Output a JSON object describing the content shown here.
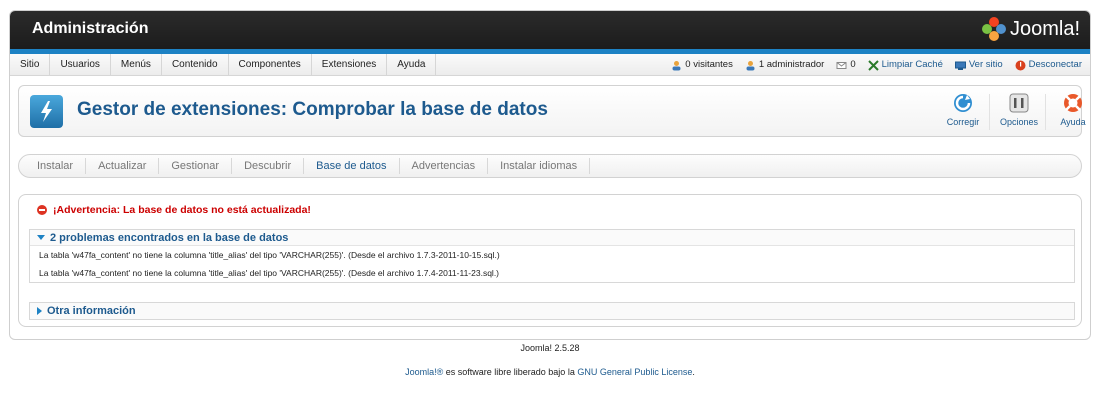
{
  "header": {
    "app_title": "Administración",
    "logo_text": "Joomla!"
  },
  "menu": {
    "items": [
      {
        "label": "Sitio"
      },
      {
        "label": "Usuarios"
      },
      {
        "label": "Menús"
      },
      {
        "label": "Contenido"
      },
      {
        "label": "Componentes"
      },
      {
        "label": "Extensiones"
      },
      {
        "label": "Ayuda"
      }
    ]
  },
  "status": {
    "visitors": "0 visitantes",
    "admins": "1 administrador",
    "messages": "0",
    "clear_cache": "Limpiar Caché",
    "view_site": "Ver sitio",
    "logout": "Desconectar"
  },
  "toolbar": {
    "title": "Gestor de extensiones: Comprobar la base de datos",
    "fix_label": "Corregir",
    "options_label": "Opciones",
    "help_label": "Ayuda"
  },
  "subnav": {
    "items": [
      {
        "label": "Instalar"
      },
      {
        "label": "Actualizar"
      },
      {
        "label": "Gestionar"
      },
      {
        "label": "Descubrir"
      },
      {
        "label": "Base de datos"
      },
      {
        "label": "Advertencias"
      },
      {
        "label": "Instalar idiomas"
      }
    ],
    "active_index": 4
  },
  "content": {
    "warning": "¡Advertencia: La base de datos no está actualizada!",
    "problems_heading": "2 problemas encontrados en la base de datos",
    "problems": [
      "La tabla 'w47fa_content' no tiene la columna 'title_alias' del tipo 'VARCHAR(255)'. (Desde el archivo 1.7.3-2011-10-15.sql.)",
      "La tabla 'w47fa_content' no tiene la columna 'title_alias' del tipo 'VARCHAR(255)'. (Desde el archivo 1.7.4-2011-11-23.sql.)"
    ],
    "other_info": "Otra información"
  },
  "footer": {
    "version": "Joomla! 2.5.28",
    "license_link_1": "Joomla!®",
    "license_text": " es software libre liberado bajo la ",
    "license_link_2": "GNU General Public License",
    "license_end": "."
  },
  "colors": {
    "accent": "#1d82c4",
    "title": "#1d5a8e",
    "warning": "#cc0000"
  }
}
